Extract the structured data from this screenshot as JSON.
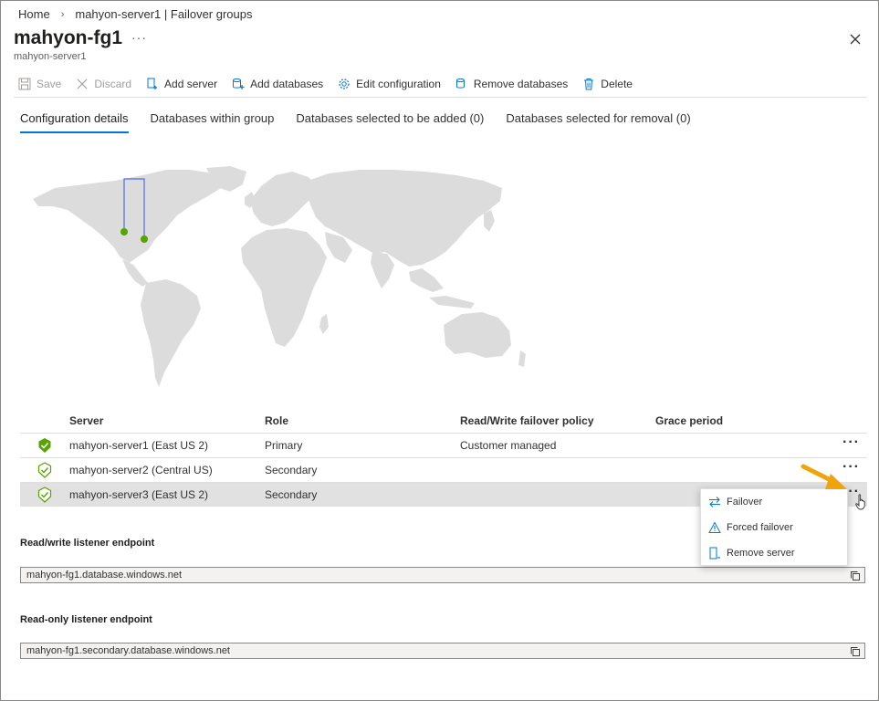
{
  "breadcrumb": {
    "home": "Home",
    "current": "mahyon-server1 | Failover groups"
  },
  "header": {
    "title": "mahyon-fg1",
    "more": "···",
    "subtitle": "mahyon-server1"
  },
  "toolbar": {
    "save": "Save",
    "discard": "Discard",
    "add_server": "Add server",
    "add_databases": "Add databases",
    "edit_configuration": "Edit configuration",
    "remove_databases": "Remove databases",
    "delete": "Delete"
  },
  "tabs": [
    {
      "label": "Configuration details",
      "active": true
    },
    {
      "label": "Databases within group",
      "active": false
    },
    {
      "label": "Databases selected to be added (0)",
      "active": false
    },
    {
      "label": "Databases selected for removal (0)",
      "active": false
    }
  ],
  "table": {
    "headers": {
      "server": "Server",
      "role": "Role",
      "policy": "Read/Write failover policy",
      "grace": "Grace period"
    },
    "rows": [
      {
        "server": "mahyon-server1 (East US 2)",
        "role": "Primary",
        "policy": "Customer managed",
        "grace": "",
        "status": "primary"
      },
      {
        "server": "mahyon-server2 (Central US)",
        "role": "Secondary",
        "policy": "",
        "grace": "",
        "status": "secondary"
      },
      {
        "server": "mahyon-server3 (East US 2)",
        "role": "Secondary",
        "policy": "",
        "grace": "",
        "status": "secondary"
      }
    ],
    "more": "···"
  },
  "context_menu": {
    "failover": "Failover",
    "forced_failover": "Forced failover",
    "remove_server": "Remove server"
  },
  "endpoints": {
    "rw_label": "Read/write listener endpoint",
    "rw_value": "mahyon-fg1.database.windows.net",
    "ro_label": "Read-only listener endpoint",
    "ro_value": "mahyon-fg1.secondary.database.windows.net"
  },
  "colors": {
    "accent": "#0078d4",
    "success": "#57a300",
    "map_land": "#dcdcdc",
    "map_link": "#4f6bed",
    "pointer_arrow": "#f0a30a"
  }
}
